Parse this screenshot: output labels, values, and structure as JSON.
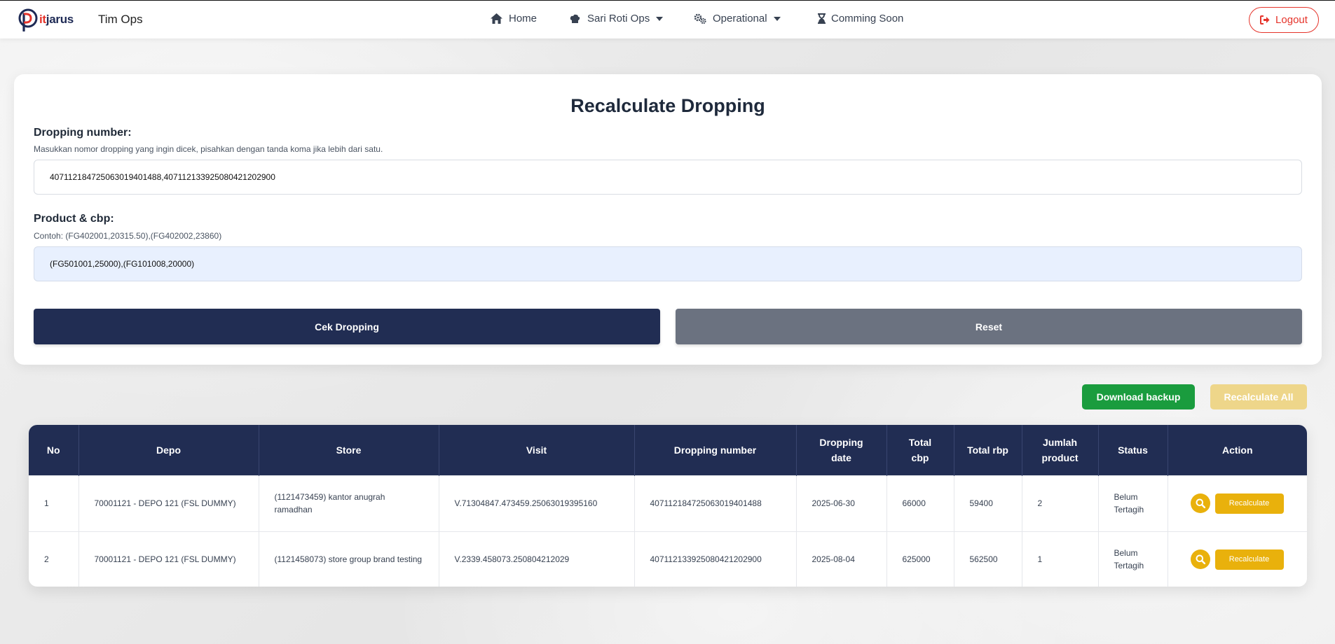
{
  "navbar": {
    "brand": "pitjarus",
    "app_title": "Tim Ops",
    "links": [
      {
        "label": "Home",
        "icon": "home-icon"
      },
      {
        "label": "Sari Roti Ops",
        "icon": "chef-hat-icon"
      },
      {
        "label": "Operational",
        "icon": "gears-icon"
      },
      {
        "label": "Comming Soon",
        "icon": "hourglass-icon"
      }
    ],
    "logout_label": "Logout"
  },
  "form": {
    "title": "Recalculate Dropping",
    "dropping": {
      "label": "Dropping number:",
      "help": "Masukkan nomor dropping yang ingin dicek, pisahkan dengan tanda koma jika lebih dari satu.",
      "value": "407112184725063019401488,407112133925080421202900"
    },
    "product": {
      "label": "Product & cbp:",
      "help": "Contoh: (FG402001,20315.50),(FG402002,23860)",
      "value": "(FG501001,25000),(FG101008,20000)"
    },
    "cek_label": "Cek Dropping",
    "reset_label": "Reset"
  },
  "actions": {
    "download_label": "Download backup",
    "recalc_all_label": "Recalculate All"
  },
  "table": {
    "headers": [
      "No",
      "Depo",
      "Store",
      "Visit",
      "Dropping number",
      "Dropping date",
      "Total cbp",
      "Total rbp",
      "Jumlah product",
      "Status",
      "Action"
    ],
    "rows": [
      {
        "no": "1",
        "depo": "70001121 - DEPO 121 (FSL DUMMY)",
        "store": "(1121473459) kantor anugrah ramadhan",
        "visit": "V.71304847.473459.25063019395160",
        "dropping_number": "407112184725063019401488",
        "dropping_date": "2025-06-30",
        "total_cbp": "66000",
        "total_rbp": "59400",
        "jumlah_product": "2",
        "status": "Belum Tertagih",
        "action_label": "Recalculate"
      },
      {
        "no": "2",
        "depo": "70001121 - DEPO 121 (FSL DUMMY)",
        "store": "(1121458073) store group brand testing",
        "visit": "V.2339.458073.250804212029",
        "dropping_number": "407112133925080421202900",
        "dropping_date": "2025-08-04",
        "total_cbp": "625000",
        "total_rbp": "562500",
        "jumlah_product": "1",
        "status": "Belum Tertagih",
        "action_label": "Recalculate"
      }
    ]
  },
  "colors": {
    "navy": "#212d53",
    "gray": "#6b7280",
    "green": "#1a9c3e",
    "yellow": "#e9b10c",
    "red": "#e5332a"
  }
}
